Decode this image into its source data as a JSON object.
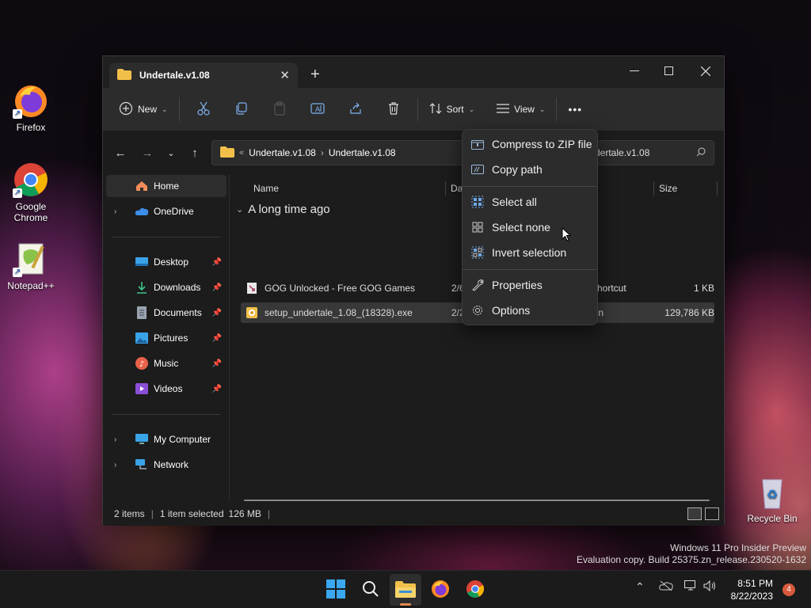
{
  "desktop": {
    "icons": [
      {
        "label": "Firefox",
        "icon": "firefox-icon"
      },
      {
        "label": "Google Chrome",
        "icon": "chrome-icon"
      },
      {
        "label": "Notepad++",
        "icon": "notepadpp-icon"
      },
      {
        "label": "Recycle Bin",
        "icon": "recycle-bin-icon"
      }
    ],
    "watermark_line1": "Windows 11 Pro Insider Preview",
    "watermark_line2": "Evaluation copy. Build 25375.zn_release.230520-1632"
  },
  "window": {
    "tab_title": "Undertale.v1.08",
    "toolbar": {
      "new_label": "New",
      "sort_label": "Sort",
      "view_label": "View",
      "more_label": "•••"
    },
    "address": {
      "overflow": "«",
      "crumbs": [
        "Undertale.v1.08",
        "Undertale.v1.08"
      ],
      "search_placeholder": "Search Undertale.v1.08",
      "search_visible": "dertale.v1.08"
    },
    "sidebar": {
      "items": [
        {
          "label": "Home"
        },
        {
          "label": "OneDrive"
        },
        {
          "label": "Desktop"
        },
        {
          "label": "Downloads"
        },
        {
          "label": "Documents"
        },
        {
          "label": "Pictures"
        },
        {
          "label": "Music"
        },
        {
          "label": "Videos"
        },
        {
          "label": "My Computer"
        },
        {
          "label": "Network"
        }
      ]
    },
    "columns": {
      "name": "Name",
      "date": "Da",
      "size": "Size"
    },
    "group_label": "A long time ago",
    "files": [
      {
        "name": "GOG Unlocked - Free GOG Games",
        "date": "2/6",
        "type": "Shortcut",
        "size": "1 KB"
      },
      {
        "name": "setup_undertale_1.08_(18328).exe",
        "date": "2/2",
        "type": "ion",
        "size": "129,786 KB"
      }
    ],
    "status": {
      "items": "2 items",
      "selected": "1 item selected",
      "size": "126 MB"
    }
  },
  "context_menu": {
    "items": [
      {
        "label": "Compress to ZIP file",
        "icon": "zip-icon"
      },
      {
        "label": "Copy path",
        "icon": "copy-path-icon"
      },
      {
        "label": "Select all",
        "icon": "select-all-icon"
      },
      {
        "label": "Select none",
        "icon": "select-none-icon"
      },
      {
        "label": "Invert selection",
        "icon": "invert-selection-icon"
      },
      {
        "label": "Properties",
        "icon": "wrench-icon"
      },
      {
        "label": "Options",
        "icon": "gear-icon"
      }
    ]
  },
  "taskbar": {
    "time": "8:51 PM",
    "date": "8/22/2023",
    "notifications": "4"
  }
}
